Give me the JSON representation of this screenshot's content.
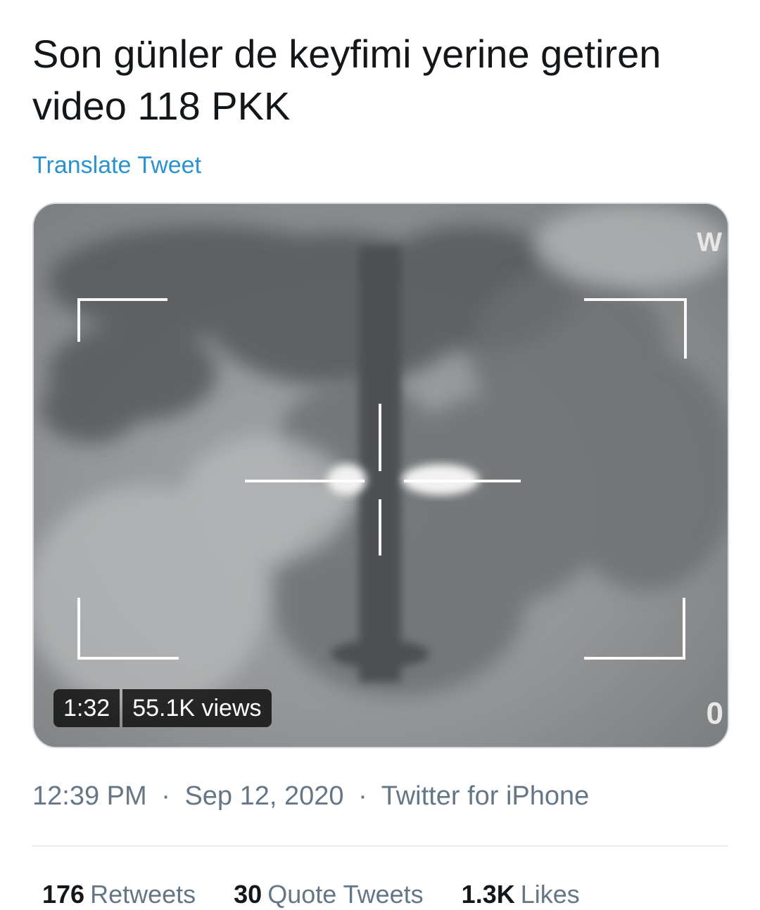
{
  "tweet": {
    "text_line1": "Son günler de keyfimi yerine getiren",
    "text_line2": "video 118 PKK",
    "translate_label": "Translate Tweet"
  },
  "video": {
    "duration": "1:32",
    "views": "55.1K views",
    "overlay_glyph_top_right": "W",
    "overlay_glyph_bottom_right": "0"
  },
  "meta": {
    "time": "12:39 PM",
    "separator": "·",
    "date": "Sep 12, 2020",
    "source": "Twitter for iPhone"
  },
  "stats": {
    "retweets_count": "176",
    "retweets_label": "Retweets",
    "quotes_count": "30",
    "quotes_label": "Quote Tweets",
    "likes_count": "1.3K",
    "likes_label": "Likes"
  },
  "colors": {
    "link": "#2b92d0",
    "muted": "#657786",
    "text": "#14171a",
    "border": "#cfd9de"
  }
}
